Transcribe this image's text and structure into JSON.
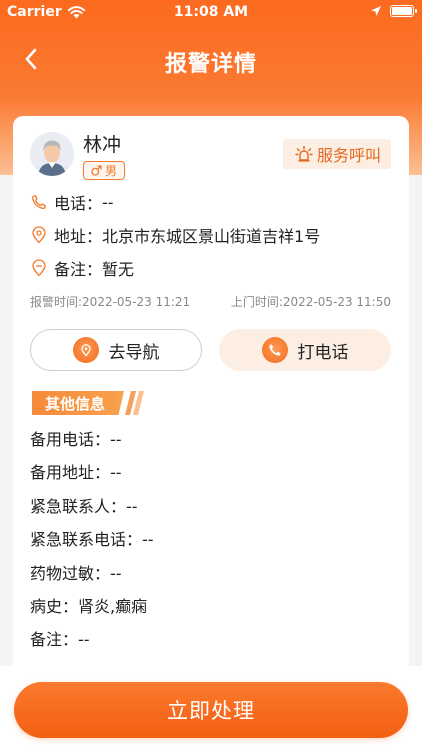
{
  "status_bar": {
    "carrier": "Carrier",
    "time": "11:08 AM"
  },
  "nav": {
    "title": "报警详情",
    "back_icon": "chevron-left-icon"
  },
  "user": {
    "name": "林冲",
    "gender": "男"
  },
  "service_call": {
    "label": "服务呼叫",
    "icon": "alarm-light-icon"
  },
  "info": {
    "phone": {
      "label": "电话：",
      "value": "--"
    },
    "address": {
      "label": "地址：",
      "value": "北京市东城区景山街道吉祥1号"
    },
    "remark": {
      "label": "备注：",
      "value": "暂无"
    }
  },
  "times": {
    "alarm": {
      "label": "报警时间:",
      "value": "2022-05-23 11:21"
    },
    "visit": {
      "label": "上门时间:",
      "value": "2022-05-23 11:50"
    }
  },
  "actions": {
    "navigate": "去导航",
    "call": "打电话"
  },
  "section": {
    "title": "其他信息"
  },
  "extra": [
    {
      "label": "备用电话：",
      "value": "--"
    },
    {
      "label": "备用地址：",
      "value": "--"
    },
    {
      "label": "紧急联系人：",
      "value": "--"
    },
    {
      "label": "紧急联系电话：",
      "value": "--"
    },
    {
      "label": "药物过敏：",
      "value": "--"
    },
    {
      "label": "病史：",
      "value": "肾炎,癫痫"
    },
    {
      "label": "备注：",
      "value": "--"
    }
  ],
  "submit": {
    "label": "立即处理"
  },
  "colors": {
    "primary": "#f26b1d",
    "accent_light": "#fdeee3"
  }
}
